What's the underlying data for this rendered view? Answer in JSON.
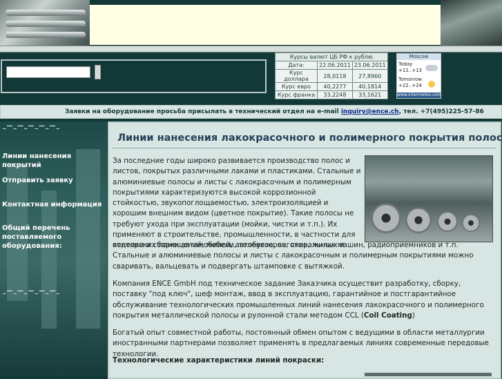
{
  "currency": {
    "caption": "Курсы валют ЦБ РФ к рублю",
    "header": {
      "label": "Дата:",
      "d1": "22.06.2011",
      "d2": "23.06.2011"
    },
    "rows": [
      {
        "label": "Курс доллара",
        "v1": "28,0118",
        "v2": "27,8960"
      },
      {
        "label": "Курс евро",
        "v1": "40,2277",
        "v2": "40,1814"
      },
      {
        "label": "Курс франка",
        "v1": "33,2248",
        "v2": "33,1621"
      }
    ]
  },
  "weather": {
    "city": "Moscow",
    "today_label": "Today",
    "today_temp": "+11..+13",
    "tomorrow_label": "Tomorrow",
    "tomorrow_temp": "+22..+24",
    "source": "www.intermeteo.com"
  },
  "notice": {
    "text_before": "Заявки на оборудование просьба присылать в технический отдел на e-mail ",
    "email": "inquiry@ence.ch",
    "text_after": ", тел. +7(495)225-57-86"
  },
  "sidebar": {
    "dashes": "_—_—_—_—_—_",
    "items": [
      "Линии нанесения покрытий",
      "Отправить заявку",
      "Контактная информация",
      "Общий перечень поставляемого оборудования:"
    ]
  },
  "page": {
    "title": "Линии нанесения лакокрасочного и полимерного покрытия полосы",
    "p1": "За последние годы широко развивается производство полос и листов, покрытых различными лаками и пластиками. Стальные и алюминиевые полосы и листы с лакокрасочным и полимерным покрытиями характеризуются высокой коррозионной стойкостью, звукопоглощаемостью, электроизоляцией и хорошим внешним видом (цветное покрытие). Такие полосы не требуют ухода при эксплуатации (мойки, чистки и т.п.). Их применяют в строительстве, промышленности, в частности для отделки и сборки автомобилей, автобусов, вагонов, жилых и конторских помещений, мебели, телевизоров, стиральных машин, радиоприемников и т.п. Стальные и алюминиевые полосы и листы с лакокрасочным и полимерным покрытиями можно сваривать, вальцевать и подвергать штамповке с вытяжкой.",
    "p2_before": "Компания ENCE GmbH под техническое задание Заказчика осуществит разработку, сборку, поставку \"под ключ\", шеф монтаж, ввод в эксплуатацию, гарантийное и постгарантийное обслуживание технологических промышленных линий нанесения лакокрасочного и полимерного покрытия металлической полосы и рулонной стали методом CCL (",
    "p2_bold": "Coil Coating",
    "p2_after": ")",
    "p3": "Богатый опыт совместной работы, постоянный обмен опытом с ведущими в области металлургии иностранными партнерами позволяет применять в предлагаемых линиях современные передовые технологии.",
    "subheading": "Технологические характеристики линий покраски:"
  }
}
